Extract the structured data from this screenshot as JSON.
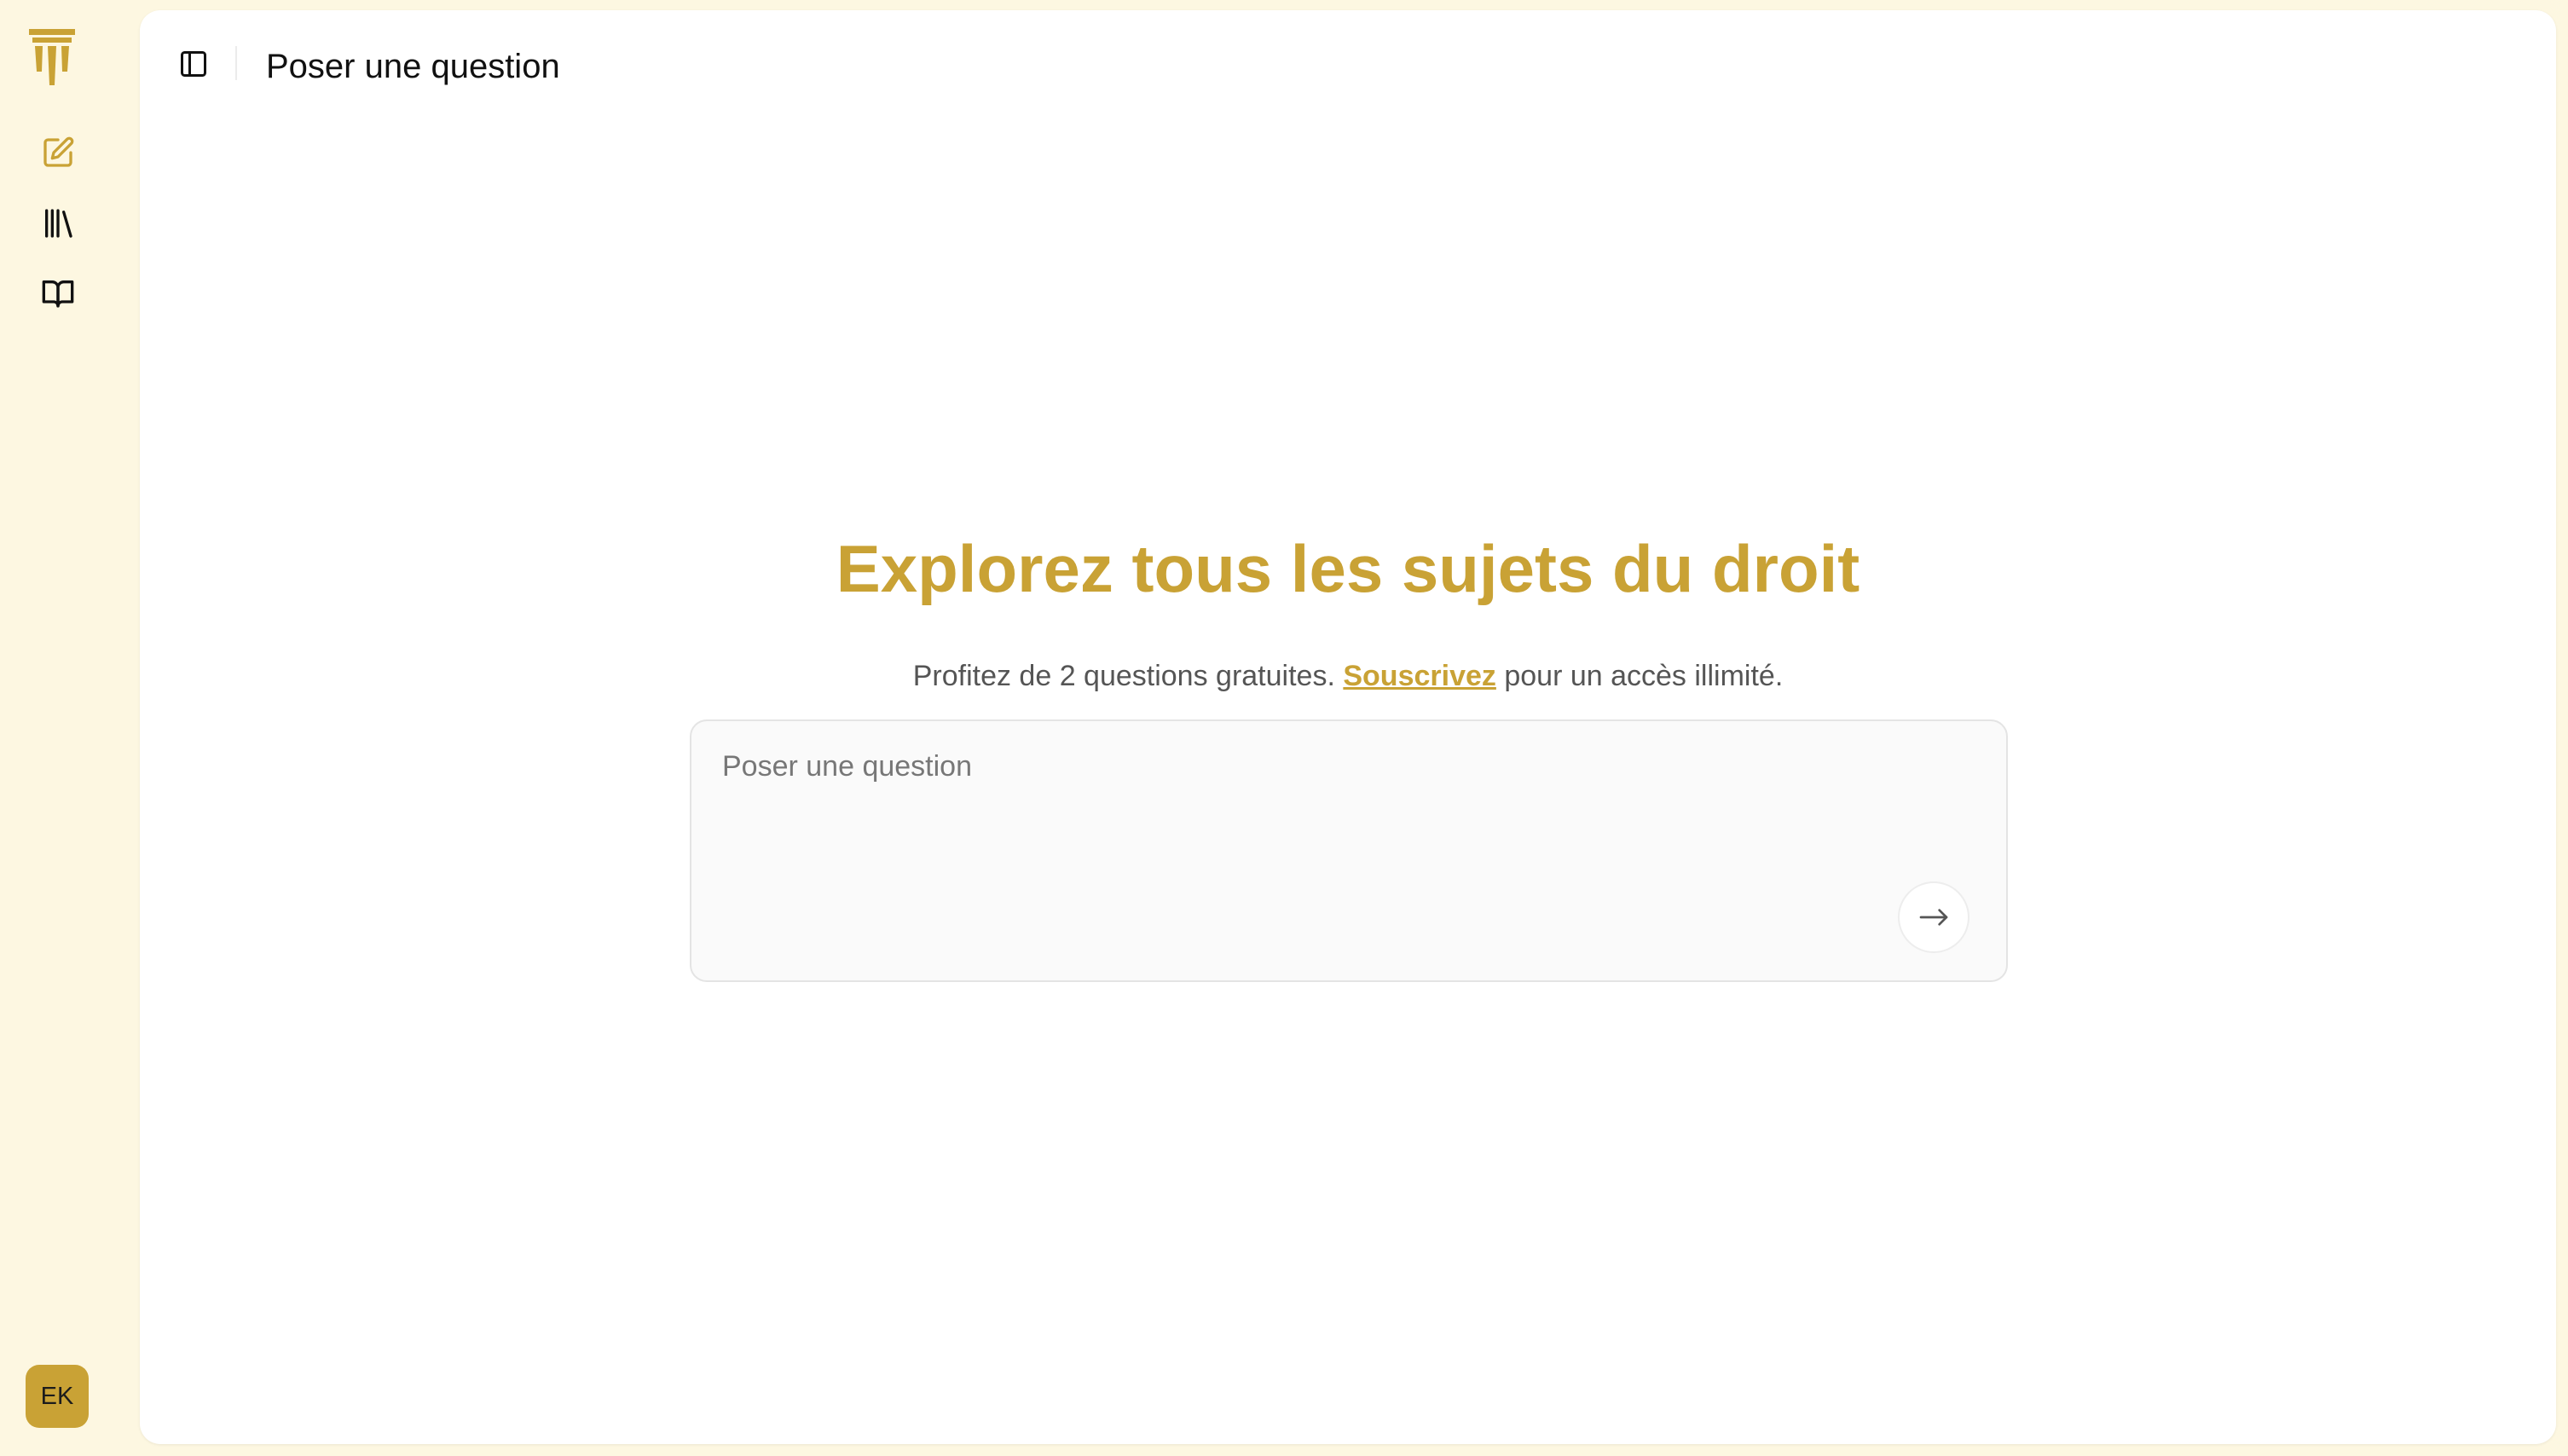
{
  "header": {
    "title": "Poser une question"
  },
  "hero": {
    "title": "Explorez tous les sujets du droit",
    "subtitle_before": "Profitez de 2 questions gratuites.",
    "subtitle_link": "Souscrivez",
    "subtitle_after": "pour un accès illimité."
  },
  "composer": {
    "placeholder": "Poser une question",
    "value": ""
  },
  "sidebar": {
    "items": [
      {
        "icon": "edit-icon"
      },
      {
        "icon": "library-icon"
      },
      {
        "icon": "book-open-icon"
      }
    ]
  },
  "user": {
    "initials": "EK"
  },
  "colors": {
    "accent": "#c9a235",
    "background": "#fdf7e1",
    "panel": "#ffffff",
    "text": "#111111"
  }
}
